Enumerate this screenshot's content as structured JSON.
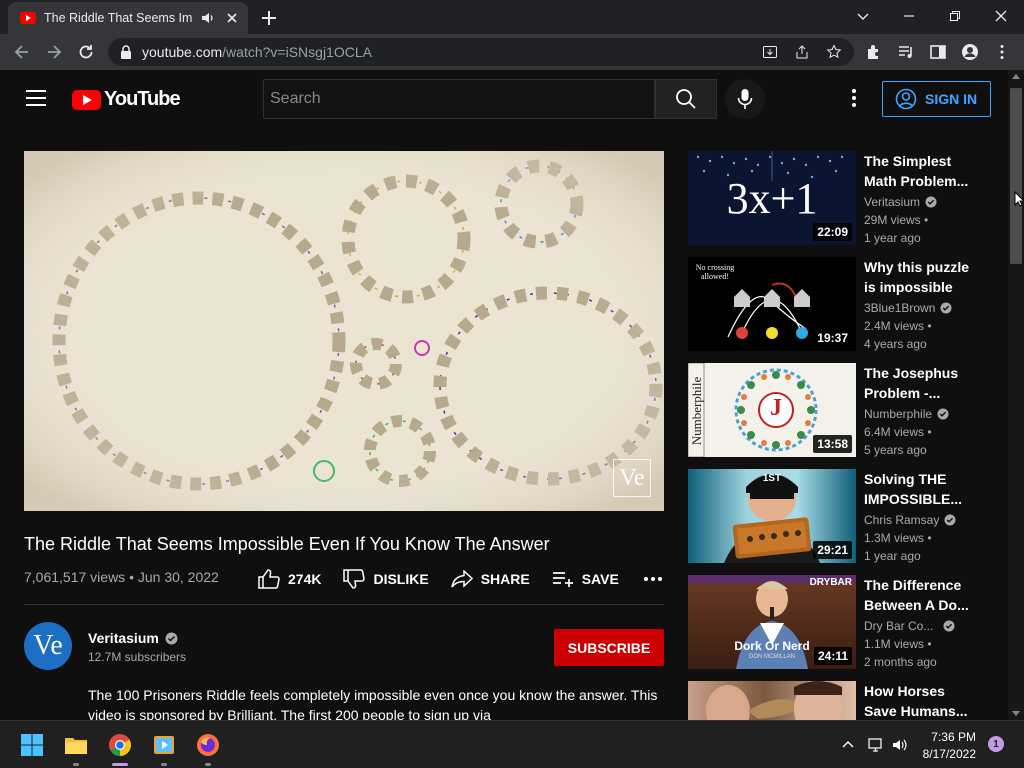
{
  "browser": {
    "tab_title": "The Riddle That Seems Impossible Even If You Know The Answer",
    "url_host": "youtube.com",
    "url_path": "/watch?v=iSNsgj1OCLA"
  },
  "youtube": {
    "logo_text": "YouTube",
    "search_placeholder": "Search",
    "signin_label": "SIGN IN"
  },
  "video": {
    "title": "The Riddle That Seems Impossible Even If You Know The Answer",
    "meta": "7,061,517 views • Jun 30, 2022",
    "likes": "274K",
    "dislike_label": "DISLIKE",
    "share_label": "SHARE",
    "save_label": "SAVE",
    "watermark": "Ve",
    "channel": {
      "avatar_text": "Ve",
      "name": "Veritasium",
      "subscribers": "12.7M subscribers",
      "subscribe_label": "SUBSCRIBE"
    },
    "description": "The 100 Prisoners Riddle feels completely impossible even once you know the answer. This video is sponsored by Brilliant. The first 200 people to sign up via"
  },
  "recommendations": [
    {
      "title": "The Simplest Math Problem...",
      "channel": "Veritasium",
      "views": "29M views •",
      "age": "1 year ago",
      "duration": "22:09",
      "thumb_text": "3x+1"
    },
    {
      "title": "Why this puzzle is impossible",
      "channel": "3Blue1Brown",
      "views": "2.4M views •",
      "age": "4 years ago",
      "duration": "19:37",
      "thumb_text": "No crossing allowed!"
    },
    {
      "title": "The Josephus Problem -...",
      "channel": "Numberphile",
      "views": "6.4M views •",
      "age": "5 years ago",
      "duration": "13:58",
      "thumb_text": "Numberphile",
      "thumb_letter": "J"
    },
    {
      "title": "Solving THE IMPOSSIBLE...",
      "channel": "Chris Ramsay",
      "views": "1.3M views •",
      "age": "1 year ago",
      "duration": "29:21",
      "thumb_text": "1ST"
    },
    {
      "title": "The Difference Between A Do...",
      "channel": "Dry Bar Co...",
      "views": "1.1M views •",
      "age": "2 months ago",
      "duration": "24:11",
      "thumb_text": "Dork Or Nerd",
      "thumb_sub": "DON MCMILLAN",
      "thumb_brand": "DRYBAR"
    },
    {
      "title": "How Horses Save Humans...",
      "channel": "",
      "views": "",
      "age": "",
      "duration": ""
    }
  ],
  "taskbar": {
    "time": "7:36 PM",
    "date": "8/17/2022",
    "notifications": "1"
  },
  "colors": {
    "yt_red": "#ff0000",
    "subscribe_red": "#cc0000",
    "signin_blue": "#3ea6ff",
    "background": "#0f0f0f"
  }
}
